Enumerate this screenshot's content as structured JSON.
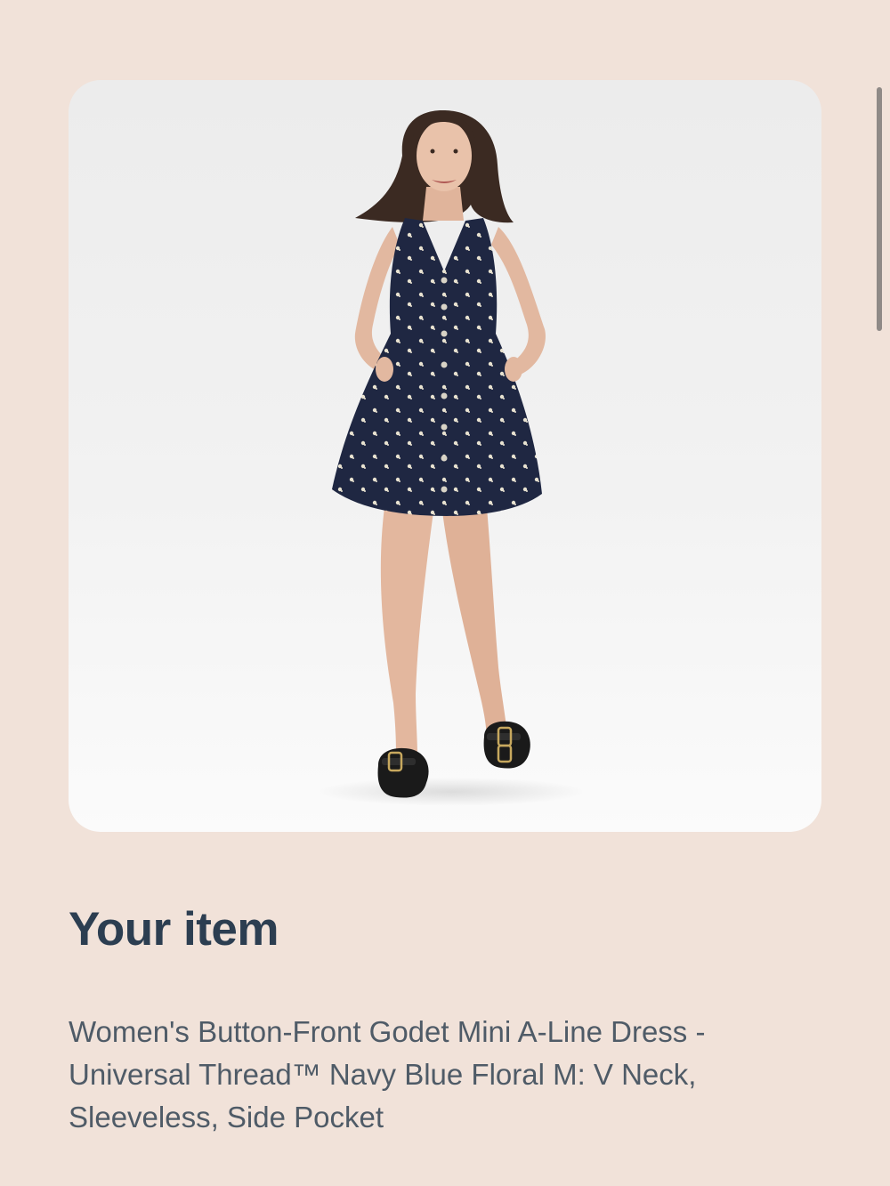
{
  "section": {
    "title": "Your item"
  },
  "item": {
    "description": "Women's Button-Front Godet Mini A-Line Dress - Universal Thread™ Navy Blue Floral M: V Neck, Sleeveless, Side Pocket"
  },
  "colors": {
    "page_background": "#f1e2d9",
    "card_background": "#eeeeee",
    "title_color": "#2c3e51",
    "text_color": "#4f5b67",
    "dress_color": "#1f2742"
  }
}
